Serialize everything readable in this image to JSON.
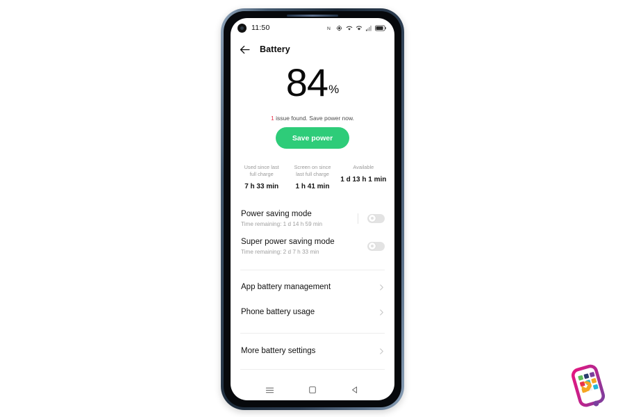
{
  "status_bar": {
    "time": "11:50",
    "icons": [
      "nfc-icon",
      "location-icon",
      "wifi-icon",
      "signal-alt-icon",
      "signal-bars-icon",
      "battery-icon"
    ],
    "battery_label": "84"
  },
  "header": {
    "back_icon": "back-arrow-icon",
    "title": "Battery"
  },
  "battery": {
    "percent": "84",
    "unit": "%",
    "issue_count": "1",
    "issue_text": " issue found. Save power now.",
    "save_button": "Save power",
    "accent_green": "#2ecc79",
    "issue_red": "#e8324a"
  },
  "stats": [
    {
      "label": "Used since last full charge",
      "value": "7 h 33 min"
    },
    {
      "label": "Screen on since last full charge",
      "value": "1 h 41 min"
    },
    {
      "label": "Available",
      "value": "1 d 13 h 1 min"
    }
  ],
  "modes": [
    {
      "title": "Power saving mode",
      "subtitle": "Time remaining:  1 d 14 h 59 min",
      "toggle_state": "off",
      "has_divider": true
    },
    {
      "title": "Super power saving mode",
      "subtitle": "Time remaining:  2 d 7 h 33 min",
      "toggle_state": "off",
      "has_divider": false
    }
  ],
  "links": [
    {
      "label": "App battery management",
      "chevron": "chevron-right-icon"
    },
    {
      "label": "Phone battery usage",
      "chevron": "chevron-right-icon"
    },
    {
      "label": "More battery settings",
      "chevron": "chevron-right-icon"
    }
  ],
  "nav_bar": {
    "recents": "menu-icon",
    "home": "home-square-icon",
    "back": "back-triangle-icon"
  },
  "watermark": {
    "name": "phone-repair-logo"
  }
}
